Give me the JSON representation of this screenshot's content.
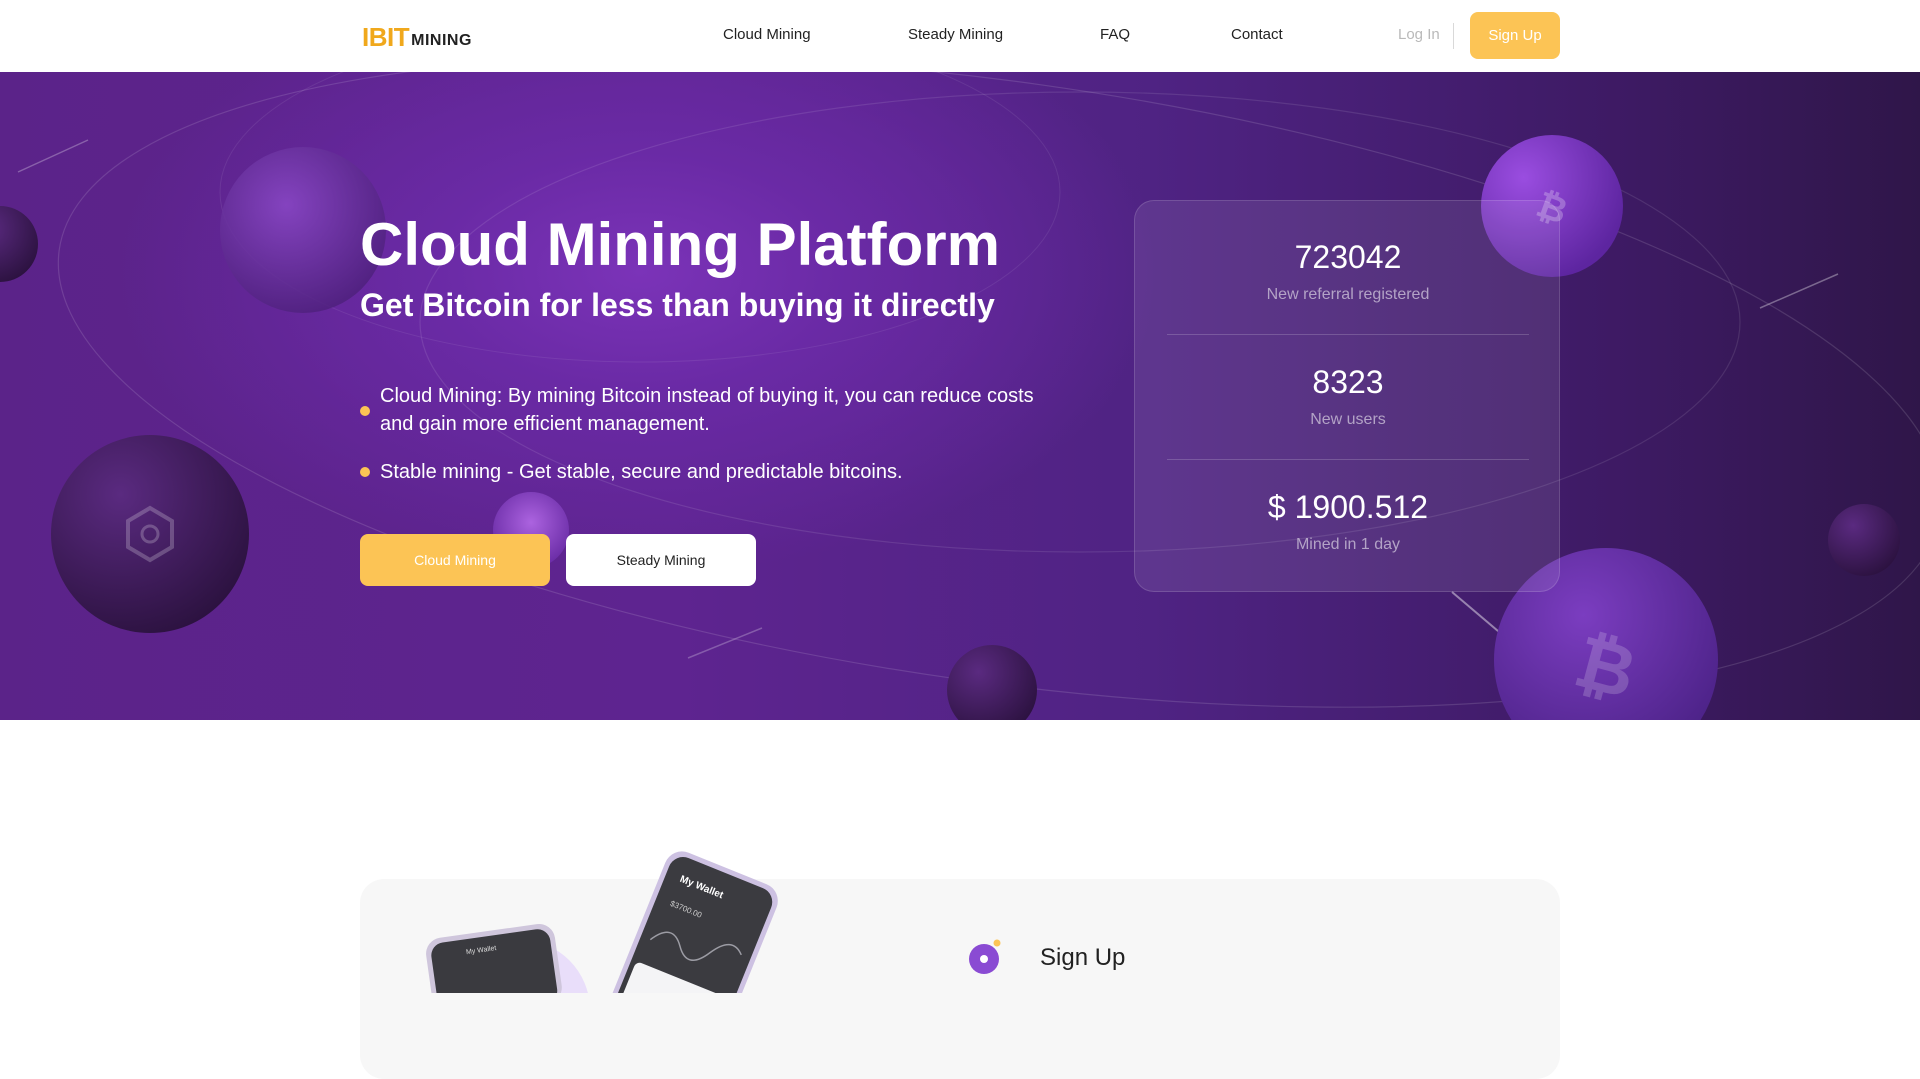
{
  "header": {
    "logo": {
      "part1": "IBIT",
      "part2": "MINING"
    },
    "nav": [
      {
        "label": "Cloud Mining"
      },
      {
        "label": "Steady Mining"
      },
      {
        "label": "FAQ"
      },
      {
        "label": "Contact"
      }
    ],
    "login_label": "Log In",
    "signup_label": "Sign Up"
  },
  "hero": {
    "title": "Cloud Mining Platform",
    "subtitle": "Get Bitcoin for less than buying it directly",
    "bullets": [
      {
        "text": "Cloud Mining: By mining Bitcoin instead of buying it, you can reduce costs and gain more efficient management."
      },
      {
        "text": "Stable mining - Get stable, secure and predictable bitcoins."
      }
    ],
    "buttons": {
      "cloud_mining": "Cloud Mining",
      "steady_mining": "Steady Mining"
    }
  },
  "stats": [
    {
      "value": "723042",
      "label": "New referral registered"
    },
    {
      "value": "8323",
      "label": "New users"
    },
    {
      "value": "$ 1900.512",
      "label": "Mined in 1 day"
    }
  ],
  "section": {
    "title": "Sign Up",
    "phone_app": {
      "title": "My Wallet",
      "amount": "$3700.00"
    }
  },
  "colors": {
    "accent": "#fcc455",
    "hero_purple": "#5e2490",
    "logo_orange": "#f0a81c"
  }
}
